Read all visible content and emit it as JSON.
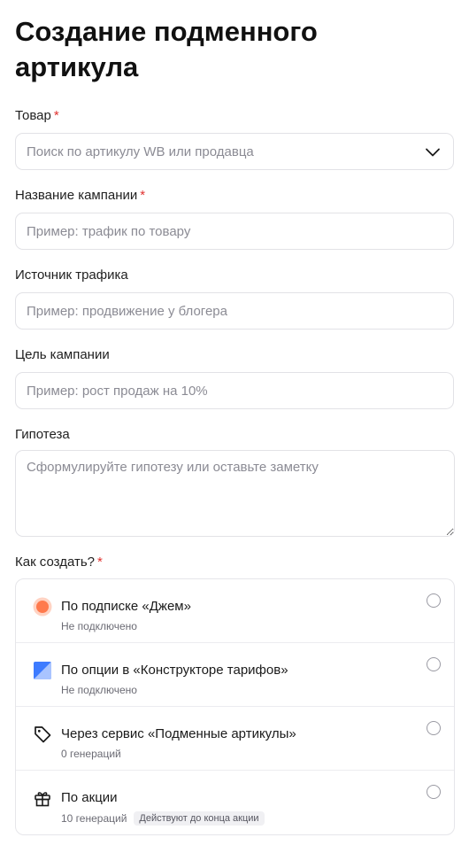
{
  "page_title": "Создание подменного артикула",
  "required_mark": "*",
  "fields": {
    "product": {
      "label": "Товар",
      "placeholder": "Поиск по артикулу WB или продавца"
    },
    "campaign_name": {
      "label": "Название кампании",
      "placeholder": "Пример: трафик по товару"
    },
    "traffic_source": {
      "label": "Источник трафика",
      "placeholder": "Пример: продвижение у блогера"
    },
    "campaign_goal": {
      "label": "Цель кампании",
      "placeholder": "Пример: рост продаж на 10%"
    },
    "hypothesis": {
      "label": "Гипотеза",
      "placeholder": "Сформулируйте гипотезу или оставьте заметку"
    }
  },
  "how_to_create": {
    "label": "Как создать?",
    "options": [
      {
        "title": "По подписке «Джем»",
        "subtitle": "Не подключено",
        "icon": "jam-dot-icon",
        "color": "#ff7a4d"
      },
      {
        "title": "По опции в «Конструкторе тарифов»",
        "subtitle": "Не подключено",
        "icon": "tariff-constructor-icon",
        "color": "#3d7bff"
      },
      {
        "title": "Через сервис «Подменные артикулы»",
        "subtitle": "0 генераций",
        "icon": "tag-icon"
      },
      {
        "title": "По акции",
        "subtitle": "10 генераций",
        "badge": "Действуют до конца акции",
        "icon": "gift-icon"
      }
    ]
  }
}
